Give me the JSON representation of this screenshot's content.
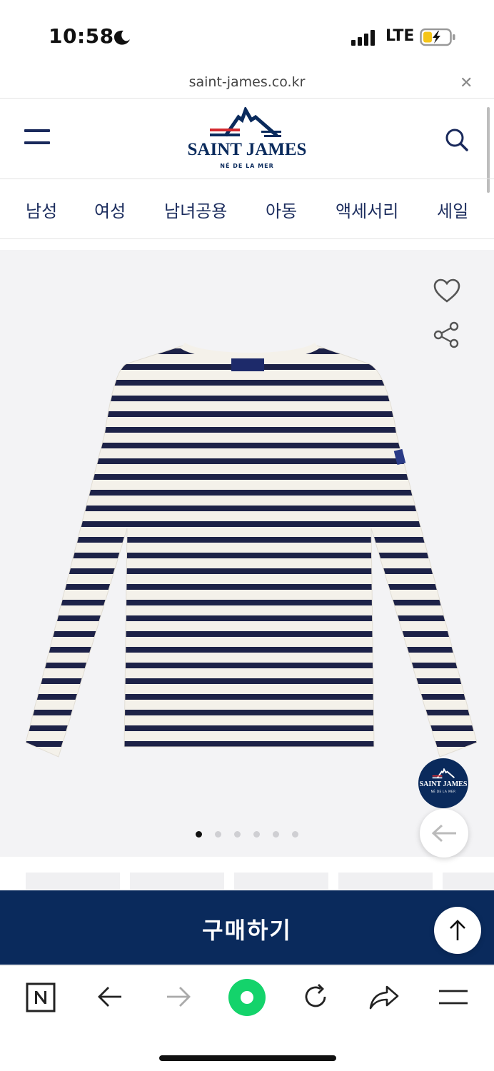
{
  "status": {
    "time": "10:58",
    "network": "LTE"
  },
  "browser": {
    "url": "saint-james.co.kr"
  },
  "header": {
    "brand": "SAINT JAMES",
    "tagline": "NÉ DE LA MER"
  },
  "nav": [
    "남성",
    "여성",
    "남녀공용",
    "아동",
    "액세서리",
    "세일"
  ],
  "product": {
    "image_count": 6,
    "active_image": 0,
    "floating_brand": "SAINT JAMES",
    "floating_tagline": "NÉ DE LA MER"
  },
  "buy": {
    "label": "구매하기"
  },
  "colors": {
    "navy": "#0a2a5c",
    "brand_red": "#d42a2f",
    "image_bg": "#f3f3f5",
    "toolbar_green": "#14d36b"
  }
}
